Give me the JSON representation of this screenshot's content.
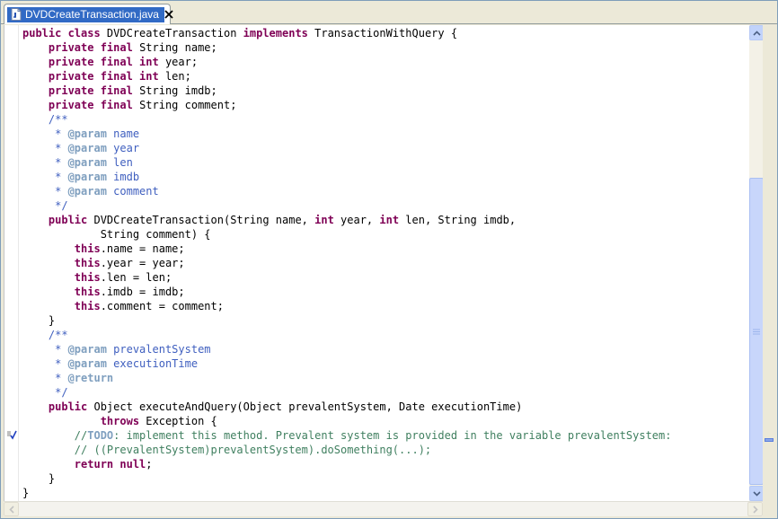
{
  "tab": {
    "title": "DVDCreateTransaction.java",
    "icon": "java-file-icon",
    "close_icon": "close-icon"
  },
  "code": {
    "lines": [
      [
        [
          "kw",
          "public class "
        ],
        [
          "p",
          "DVDCreateTransaction "
        ],
        [
          "kw",
          "implements "
        ],
        [
          "p",
          "TransactionWithQuery {"
        ]
      ],
      [
        [
          "p",
          "    "
        ],
        [
          "kw",
          "private final "
        ],
        [
          "p",
          "String name;"
        ]
      ],
      [
        [
          "p",
          "    "
        ],
        [
          "kw",
          "private final int "
        ],
        [
          "p",
          "year;"
        ]
      ],
      [
        [
          "p",
          "    "
        ],
        [
          "kw",
          "private final int "
        ],
        [
          "p",
          "len;"
        ]
      ],
      [
        [
          "p",
          "    "
        ],
        [
          "kw",
          "private final "
        ],
        [
          "p",
          "String imdb;"
        ]
      ],
      [
        [
          "p",
          "    "
        ],
        [
          "kw",
          "private final "
        ],
        [
          "p",
          "String comment;"
        ]
      ],
      [
        [
          "jd",
          "    /**"
        ]
      ],
      [
        [
          "jd",
          "     * "
        ],
        [
          "jt",
          "@param"
        ],
        [
          "jd",
          " name"
        ]
      ],
      [
        [
          "jd",
          "     * "
        ],
        [
          "jt",
          "@param"
        ],
        [
          "jd",
          " year"
        ]
      ],
      [
        [
          "jd",
          "     * "
        ],
        [
          "jt",
          "@param"
        ],
        [
          "jd",
          " len"
        ]
      ],
      [
        [
          "jd",
          "     * "
        ],
        [
          "jt",
          "@param"
        ],
        [
          "jd",
          " imdb"
        ]
      ],
      [
        [
          "jd",
          "     * "
        ],
        [
          "jt",
          "@param"
        ],
        [
          "jd",
          " comment"
        ]
      ],
      [
        [
          "jd",
          "     */"
        ]
      ],
      [
        [
          "p",
          "    "
        ],
        [
          "kw",
          "public "
        ],
        [
          "p",
          "DVDCreateTransaction(String name, "
        ],
        [
          "kw",
          "int "
        ],
        [
          "p",
          "year, "
        ],
        [
          "kw",
          "int "
        ],
        [
          "p",
          "len, String imdb,"
        ]
      ],
      [
        [
          "p",
          "            String comment) {"
        ]
      ],
      [
        [
          "p",
          "        "
        ],
        [
          "kw",
          "this"
        ],
        [
          "p",
          ".name = name;"
        ]
      ],
      [
        [
          "p",
          "        "
        ],
        [
          "kw",
          "this"
        ],
        [
          "p",
          ".year = year;"
        ]
      ],
      [
        [
          "p",
          "        "
        ],
        [
          "kw",
          "this"
        ],
        [
          "p",
          ".len = len;"
        ]
      ],
      [
        [
          "p",
          "        "
        ],
        [
          "kw",
          "this"
        ],
        [
          "p",
          ".imdb = imdb;"
        ]
      ],
      [
        [
          "p",
          "        "
        ],
        [
          "kw",
          "this"
        ],
        [
          "p",
          ".comment = comment;"
        ]
      ],
      [
        [
          "p",
          "    }"
        ]
      ],
      [
        [
          "jd",
          "    /**"
        ]
      ],
      [
        [
          "jd",
          "     * "
        ],
        [
          "jt",
          "@param"
        ],
        [
          "jd",
          " prevalentSystem"
        ]
      ],
      [
        [
          "jd",
          "     * "
        ],
        [
          "jt",
          "@param"
        ],
        [
          "jd",
          " executionTime"
        ]
      ],
      [
        [
          "jd",
          "     * "
        ],
        [
          "jt",
          "@return"
        ]
      ],
      [
        [
          "jd",
          "     */"
        ]
      ],
      [
        [
          "p",
          "    "
        ],
        [
          "kw",
          "public "
        ],
        [
          "p",
          "Object executeAndQuery(Object prevalentSystem, Date executionTime)"
        ]
      ],
      [
        [
          "p",
          "            "
        ],
        [
          "kw",
          "throws "
        ],
        [
          "p",
          "Exception {"
        ]
      ],
      [
        [
          "cm",
          "        //"
        ],
        [
          "todo",
          "TODO"
        ],
        [
          "cm",
          ": implement this method. Prevalent system is provided in the variable prevalentSystem:"
        ]
      ],
      [
        [
          "cm",
          "        // ((PrevalentSystem)prevalentSystem).doSomething(...);"
        ]
      ],
      [
        [
          "p",
          "        "
        ],
        [
          "kw",
          "return null"
        ],
        [
          "p",
          ";"
        ]
      ],
      [
        [
          "p",
          "    }"
        ]
      ],
      [
        [
          "p",
          "}"
        ]
      ]
    ]
  },
  "icons": {
    "task": "task-marker-icon",
    "scroll_up": "scroll-up-arrow-icon",
    "scroll_down": "scroll-down-arrow-icon",
    "scroll_left": "scroll-left-arrow-icon",
    "scroll_right": "scroll-right-arrow-icon",
    "grip": "scroll-grip-icon"
  },
  "colors": {
    "keyword": "#7f0055",
    "javadoc": "#3f5fbf",
    "javadoc_tag": "#7f9fbf",
    "comment": "#3f7f5f",
    "selection": "#316ac5"
  }
}
